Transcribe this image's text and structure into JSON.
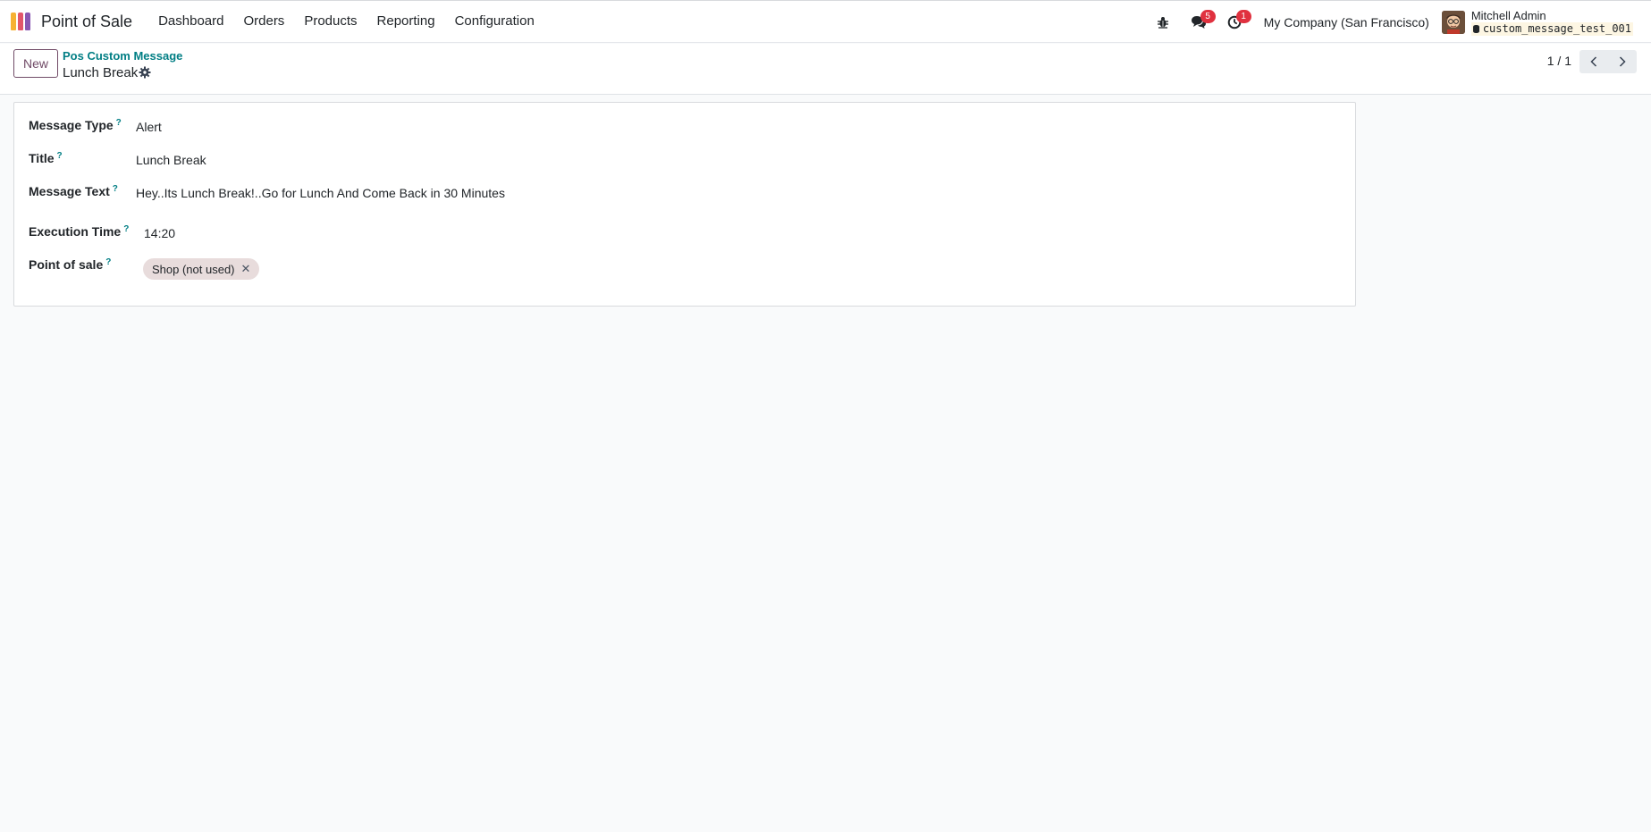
{
  "app": {
    "name": "Point of Sale",
    "logo_colors": [
      "#f6b133",
      "#e2566a",
      "#8957b2"
    ]
  },
  "menu": {
    "items": [
      "Dashboard",
      "Orders",
      "Products",
      "Reporting",
      "Configuration"
    ]
  },
  "systray": {
    "messages_count": "5",
    "activities_count": "1",
    "company": "My Company (San Francisco)",
    "user_name": "Mitchell Admin",
    "database": "custom_message_test_001"
  },
  "control_panel": {
    "new_label": "New",
    "breadcrumb_parent": "Pos Custom Message",
    "breadcrumb_current": "Lunch Break",
    "pager_value": "1 / 1"
  },
  "form": {
    "message_type": {
      "label": "Message Type",
      "help": "?",
      "value": "Alert"
    },
    "title": {
      "label": "Title",
      "help": "?",
      "value": "Lunch Break"
    },
    "message_text": {
      "label": "Message Text",
      "help": "?",
      "value": "Hey..Its Lunch Break!..Go for Lunch And Come Back in 30 Minutes"
    },
    "execution_time": {
      "label": "Execution Time",
      "help": "?",
      "value": "14:20"
    },
    "point_of_sale": {
      "label": "Point of sale",
      "help": "?",
      "tags": [
        "Shop (not used)"
      ]
    }
  },
  "colors": {
    "primary": "#714b67",
    "link": "#017e84",
    "badge": "#e0313f"
  }
}
